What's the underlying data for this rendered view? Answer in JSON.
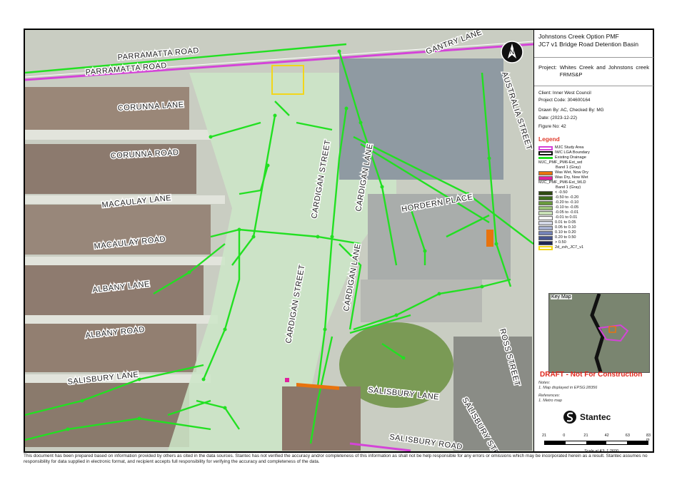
{
  "title": {
    "line1": "Johnstons Creek Option PMF",
    "line2": "JC7 v1 Bridge Road Detention Basin"
  },
  "project": {
    "label": "Project:",
    "value": "Whites Creek and Johnstons creek FRMS&P"
  },
  "meta": {
    "client": "Client:  Inner West Council",
    "project_code": "Project Code:  304600164",
    "drawn_by": "Drawn By:  AC, Checked By: MG",
    "date": "Date:  (2023-12-22)",
    "figure_no": "Figure No:  42"
  },
  "legend": {
    "title": "Legend",
    "items": [
      {
        "label": "MJC Study Area",
        "color": "#d444d8"
      },
      {
        "label": "IWC LGA Boundary",
        "color": "#111111"
      },
      {
        "label": "Existing Drainage",
        "color": "#22e022"
      }
    ],
    "group_wd": "MJC_PMF_PM6-Ext_wd",
    "group_wd_band": "Band 1 (Gray)",
    "wd_items": [
      {
        "label": "Was Wet, Now Dry",
        "color": "#e8730e"
      },
      {
        "label": "Was Dry, Now Wet",
        "color": "#e0209e"
      }
    ],
    "group_wld": "MJC_PMF_PM6-Ext_WLD",
    "group_wld_band": "Band 1 (Gray)",
    "wld_items": [
      {
        "label": "< -0.50",
        "color": "#2f4a12"
      },
      {
        "label": "-0.50 to -0.20",
        "color": "#3f6e1e"
      },
      {
        "label": "-0.20 to -0.10",
        "color": "#6a9a3e"
      },
      {
        "label": "-0.10 to -0.05",
        "color": "#9cc27a"
      },
      {
        "label": "-0.05 to -0.01",
        "color": "#c8e0b6"
      },
      {
        "label": "-0.01 to 0.01",
        "color": "#f4f4f4"
      },
      {
        "label": "0.01 to 0.05",
        "color": "#d4d8e6"
      },
      {
        "label": "0.05 to 0.10",
        "color": "#a7b0d0"
      },
      {
        "label": "0.10 to 0.20",
        "color": "#7482b6"
      },
      {
        "label": "0.20 to 0.50",
        "color": "#45538e"
      },
      {
        "label": "> 0.50",
        "color": "#1f2756"
      }
    ],
    "basin": {
      "label": "2d_zsh_JC7_v1",
      "color": "#f2d61a"
    }
  },
  "keymap_label": "Key Map",
  "draft": "DRAFT - Not For Construction",
  "notes": {
    "title": "Notes:",
    "n1": "1. Map displayed in EPSG:28356",
    "ref_title": "References:",
    "r1": "1. Metro map"
  },
  "logo_text": "Stantec",
  "scale": {
    "ticks": [
      "21",
      "0",
      "21",
      "42",
      "63",
      "83 m"
    ],
    "label": "Scale at A3: 1:2600"
  },
  "north_label": "N",
  "streets": {
    "parramatta_1": "PARRAMATTA ROAD",
    "parramatta_2": "PARRAMATTA ROAD",
    "gantry": "GANTRY LANE",
    "australia": "AUSTRALIA STREET",
    "corunna_lane": "CORUNNA LANE",
    "corunna_road": "CORUNNA ROAD",
    "macaulay_lane": "MACAULAY LANE",
    "macaulay_road": "MACAULAY ROAD",
    "albany_lane": "ALBANY LANE",
    "albany_road": "ALBANY ROAD",
    "salisbury_lane_w": "SALISBURY LANE",
    "cardigan_st_n": "CARDIGAN STREET",
    "cardigan_ln_n": "CARDIGAN LANE",
    "hordern": "HORDERN PLACE",
    "cardigan_st_s": "CARDIGAN STREET",
    "cardigan_ln_s": "CARDIGAN LANE",
    "ross": "ROSS STREET",
    "salisbury_lane_e": "SALISBURY LANE",
    "salisbury_street": "SALISBURY STREET",
    "salisbury_road": "SALISBURY ROAD"
  },
  "disclaimer": "This document has been prepared based on information provided by others as cited in the data sources. Stantec has not verified the accuracy and/or completeness of this information as shall not be help responsible for any errors or omissions which may be incorporated herein as a result. Stantec assumes no responsibility for data supplied in electronic format, and recipient accepts full responsibility for verifying the accuracy and completeness of the data."
}
